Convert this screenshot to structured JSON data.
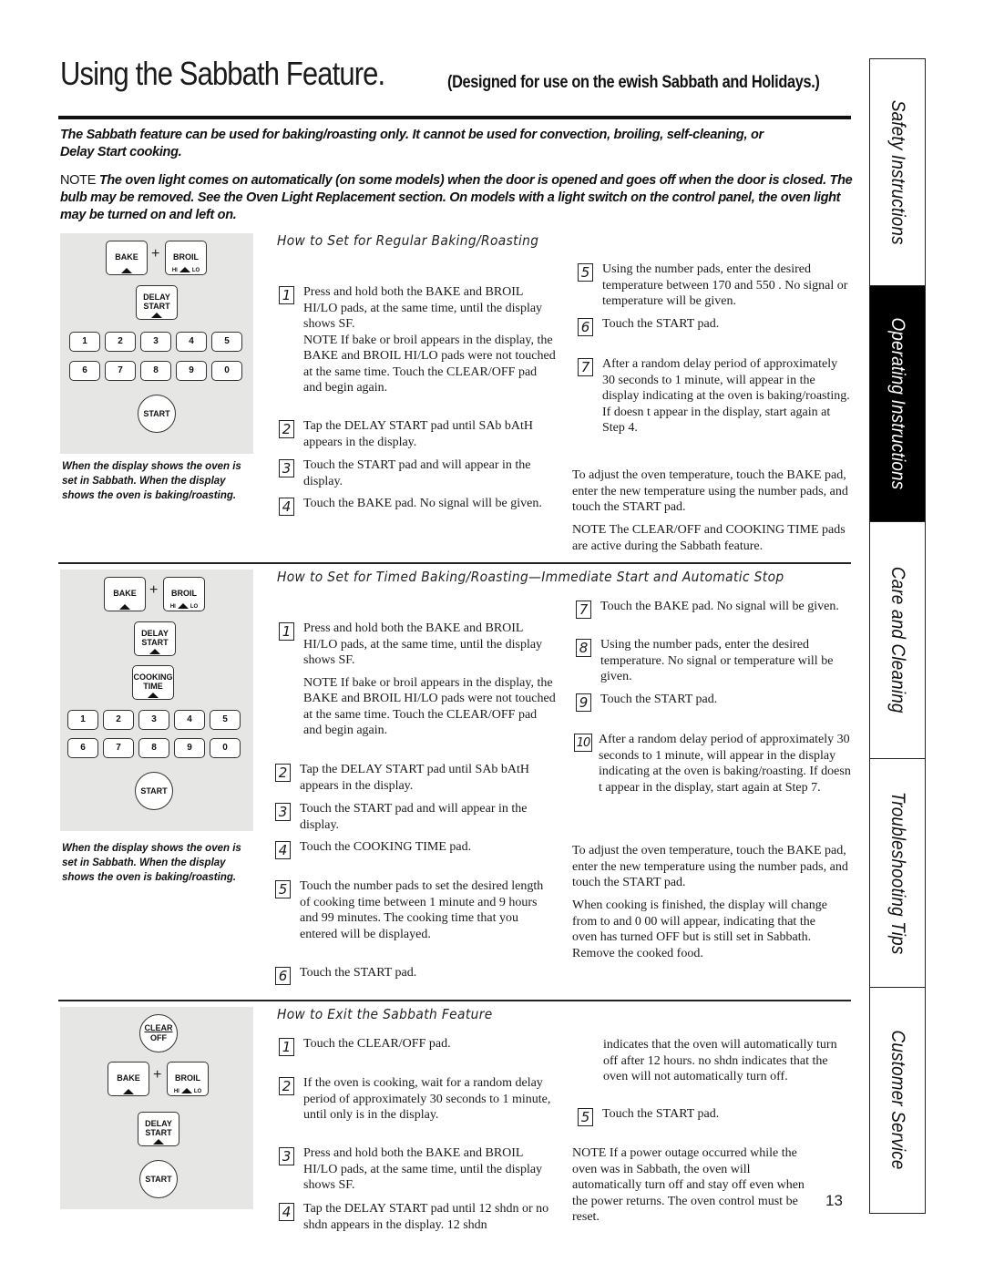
{
  "header": {
    "title": "Using the Sabbath Feature.",
    "subtitle": "(Designed for use on the   ewish Sabbath and Holidays.)"
  },
  "intro": {
    "paragraph": "The Sabbath feature can be used for baking/roasting only. It cannot be used for convection, broiling, self-cleaning, or Delay Start cooking.",
    "note_label": "NOTE",
    "note_text": " The oven light comes on automatically (on some models) when the door is opened and goes off when the door is closed. The bulb may be removed. See the Oven Light Replacement section. On models with a light switch on the control panel, the oven light may be turned on and left on."
  },
  "keypad": {
    "bake": "BAKE",
    "broil": "BROIL",
    "hi": "HI",
    "lo": "LO",
    "plus": "+",
    "delay": "DELAY",
    "start_word": "START",
    "cooking": "COOKING",
    "time": "TIME",
    "start": "START",
    "clear": "CLEAR",
    "off": "OFF",
    "digits_row1": [
      "1",
      "2",
      "3",
      "4",
      "5"
    ],
    "digits_row2": [
      "6",
      "7",
      "8",
      "9",
      "0"
    ]
  },
  "panel_caption": "When the display shows      the oven is set in Sabbath. When the display shows            the oven is baking/roasting.",
  "sections": {
    "regular": {
      "heading": "How to Set for Regular Baking/Roasting",
      "steps": [
        {
          "n": "1",
          "text": "Press and hold both the BAKE and BROIL HI/LO pads, at the same time, until the display shows SF."
        },
        {
          "n": "2",
          "text": "Tap the DELAY START pad until SAb bAtH appears in the display."
        },
        {
          "n": "3",
          "text": "Touch the START pad and     will appear in the display."
        },
        {
          "n": "4",
          "text": "Touch the BAKE pad. No signal will be given."
        },
        {
          "n": "5",
          "text": "Using the number pads, enter the desired temperature between 170   and 550  . No signal or temperature will be given."
        },
        {
          "n": "6",
          "text": "Touch the START pad."
        },
        {
          "n": "7",
          "text": "After a random delay period of approximately 30 seconds to 1 minute,        will appear in the display indicating at the oven is baking/roasting. If        doesn t appear in the display, start again at Step 4."
        }
      ],
      "step1_note": "NOTE If bake or broil appears in the display, the BAKE and BROIL HI/LO pads were not touched at the same time. Touch the CLEAR/OFF pad and begin again.",
      "adjust": "To adjust the oven temperature, touch the BAKE pad, enter the new temperature using the number pads, and touch the START pad.",
      "note": "NOTE The CLEAR/OFF and COOKING TIME pads are active during the Sabbath feature."
    },
    "timed": {
      "heading": "How to Set for Timed Baking/Roasting—Immediate Start and Automatic Stop",
      "steps": [
        {
          "n": "1",
          "text": "Press and hold both the BAKE and BROIL HI/LO pads, at the same time, until the display shows SF."
        },
        {
          "n": "2",
          "text": "Tap the DELAY START pad until SAb bAtH appears in the display."
        },
        {
          "n": "3",
          "text": "Touch the START pad and     will appear in the display."
        },
        {
          "n": "4",
          "text": "Touch the COOKING TIME pad."
        },
        {
          "n": "5",
          "text": "Touch the number pads to set the desired length of cooking time between 1 minute and 9 hours and 99 minutes. The cooking time that you entered will be displayed."
        },
        {
          "n": "6",
          "text": "Touch the START pad."
        },
        {
          "n": "7",
          "text": "Touch the BAKE pad. No signal will be given."
        },
        {
          "n": "8",
          "text": "Using the number pads, enter the desired temperature. No signal or temperature will be given."
        },
        {
          "n": "9",
          "text": "Touch the START pad."
        },
        {
          "n": "10",
          "text": "After a random delay period of approximately 30 seconds to 1 minute,        will appear in the display indicating at the oven is baking/roasting. If        doesn t appear in the display, start again at Step 7."
        }
      ],
      "step1_note": "NOTE If bake or broil appears in the display, the BAKE and BROIL HI/LO pads were not touched at the same time. Touch the CLEAR/OFF pad and begin again.",
      "adjust": "To adjust the oven temperature, touch the BAKE pad, enter the new temperature using the number pads, and touch the START pad.",
      "finished": "When cooking is finished, the display will change from          to     and 0 00 will appear, indicating that the oven has turned OFF but is still set in Sabbath. Remove the cooked food."
    },
    "exit": {
      "heading": "How to Exit the Sabbath Feature",
      "steps": [
        {
          "n": "1",
          "text": "Touch the CLEAR/OFF pad."
        },
        {
          "n": "2",
          "text": "If the oven is cooking, wait for a random delay period of approximately 30 seconds to 1 minute, until only      is in the display."
        },
        {
          "n": "3",
          "text": "Press and hold both the BAKE and BROIL HI/LO pads, at the same time, until the display shows SF."
        },
        {
          "n": "4",
          "text": "Tap the DELAY START pad until 12 shdn or no shdn appears in the display. 12 shdn"
        },
        {
          "n": "5",
          "text": "Touch the START pad."
        }
      ],
      "step4_cont": "indicates that the oven will automatically turn off after 12 hours. no shdn indicates that the oven will not automatically turn off.",
      "note": "NOTE If a power outage occurred while the oven was in Sabbath, the oven will automatically turn off and stay off even when the power returns. The oven control must be reset."
    }
  },
  "side_tabs": [
    {
      "label": "Safety Instructions",
      "active": false
    },
    {
      "label": "Operating Instructions",
      "active": true
    },
    {
      "label": "Care and Cleaning",
      "active": false
    },
    {
      "label": "Troubleshooting Tips",
      "active": false
    },
    {
      "label": "Customer Service",
      "active": false
    }
  ],
  "page_number": "13"
}
